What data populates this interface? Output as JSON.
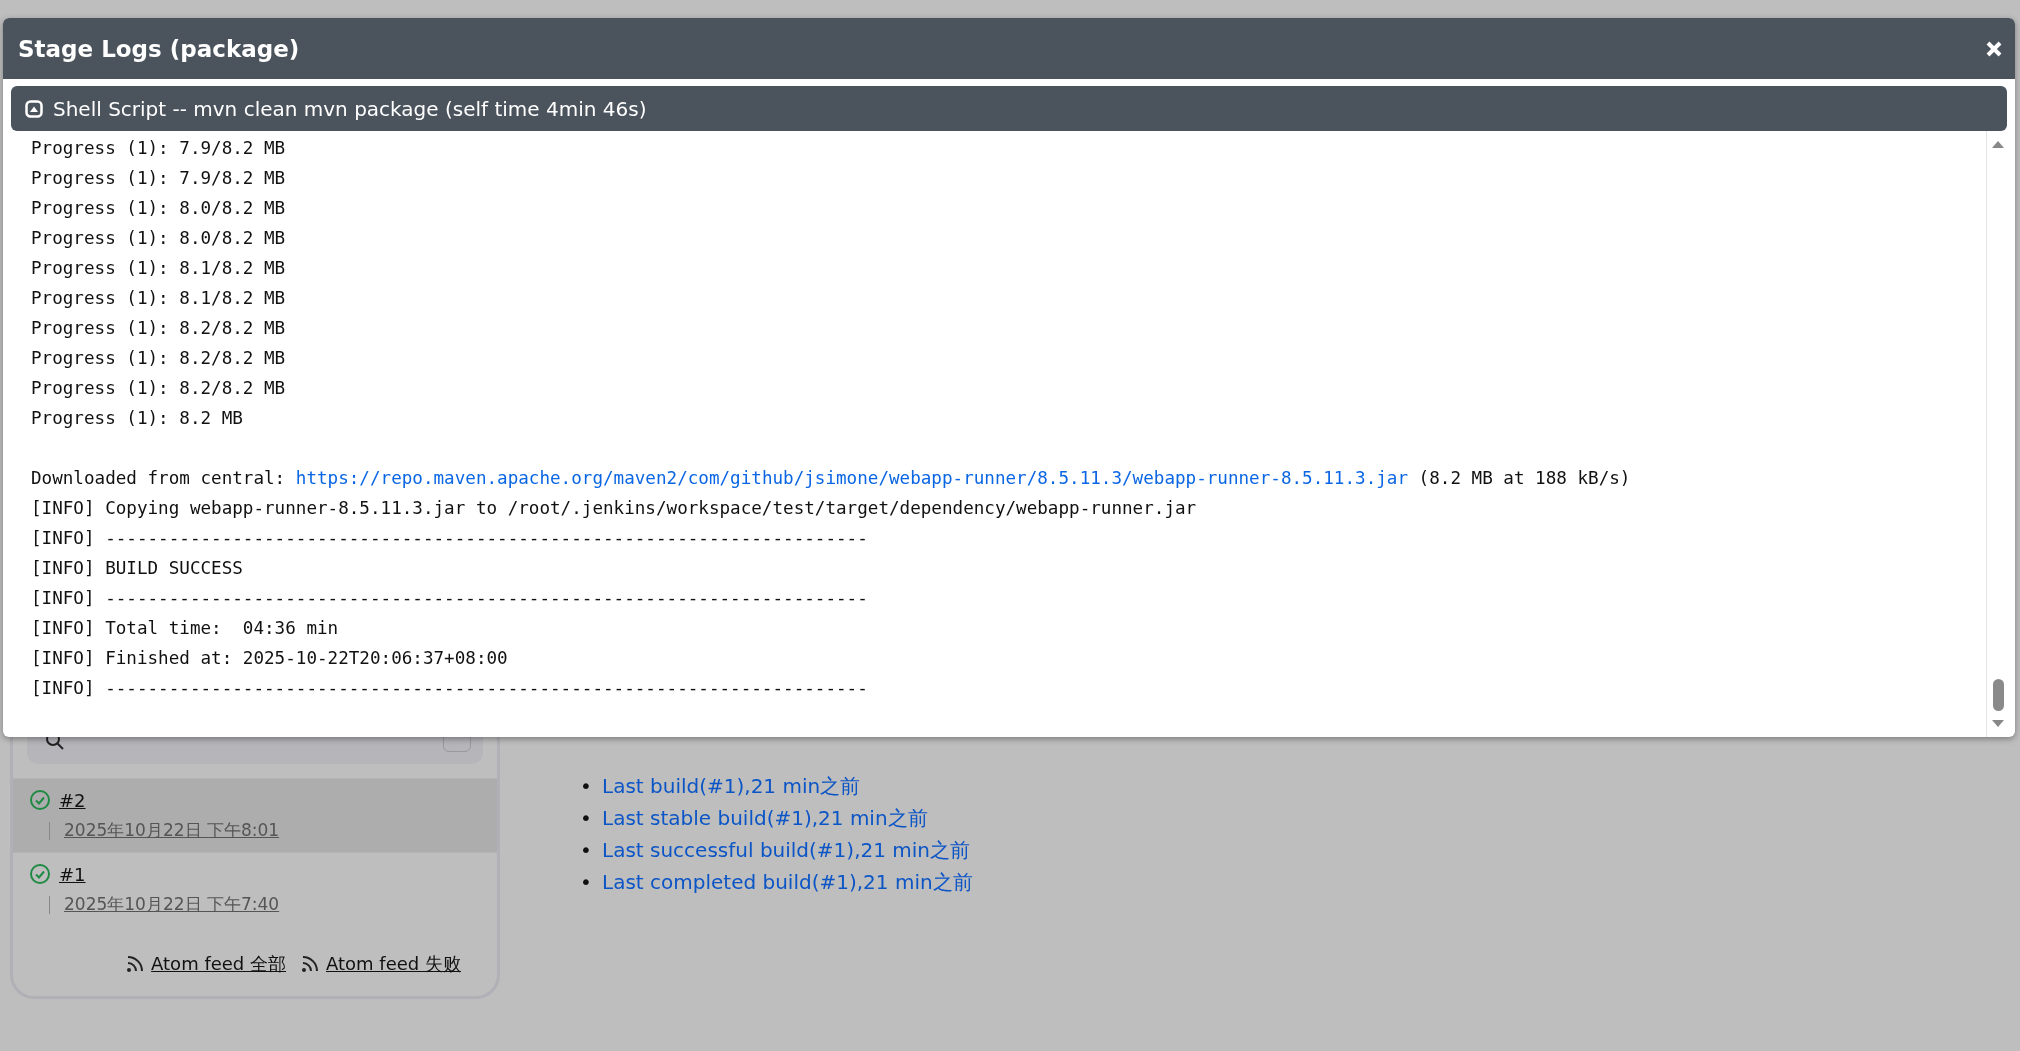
{
  "history": {
    "builds": [
      {
        "number": "#2",
        "date": "2025年10月22日 下午8:01",
        "selected": true
      },
      {
        "number": "#1",
        "date": "2025年10月22日 下午7:40",
        "selected": false
      }
    ],
    "feeds": [
      "Atom feed 全部",
      "Atom feed 失败"
    ]
  },
  "permalinks": [
    {
      "bullet": "•",
      "label": "Last build(#1),21 min之前"
    },
    {
      "bullet": "•",
      "label": "Last stable build(#1),21 min之前"
    },
    {
      "bullet": "•",
      "label": "Last successful build(#1),21 min之前"
    },
    {
      "bullet": "•",
      "label": "Last completed build(#1),21 min之前"
    }
  ],
  "dialog": {
    "title": "Stage Logs (package)",
    "step": {
      "title": "Shell Script -- mvn clean mvn package (self time 4min 46s)",
      "expanded": true
    },
    "log_lines": [
      {
        "text": "Progress (1): 7.9/8.2 MB"
      },
      {
        "text": "Progress (1): 7.9/8.2 MB"
      },
      {
        "text": "Progress (1): 8.0/8.2 MB"
      },
      {
        "text": "Progress (1): 8.0/8.2 MB"
      },
      {
        "text": "Progress (1): 8.1/8.2 MB"
      },
      {
        "text": "Progress (1): 8.1/8.2 MB"
      },
      {
        "text": "Progress (1): 8.2/8.2 MB"
      },
      {
        "text": "Progress (1): 8.2/8.2 MB"
      },
      {
        "text": "Progress (1): 8.2/8.2 MB"
      },
      {
        "text": "Progress (1): 8.2 MB"
      },
      {
        "kind": "blank"
      },
      {
        "text": "Downloaded from central: ",
        "link": "https://repo.maven.apache.org/maven2/com/github/jsimone/webapp-runner/8.5.11.3/webapp-runner-8.5.11.3.jar",
        "after": " (8.2 MB at 188 kB/s)"
      },
      {
        "text": "[INFO] Copying webapp-runner-8.5.11.3.jar to /root/.jenkins/workspace/test/target/dependency/webapp-runner.jar"
      },
      {
        "text": "[INFO] ------------------------------------------------------------------------"
      },
      {
        "text": "[INFO] BUILD SUCCESS"
      },
      {
        "text": "[INFO] ------------------------------------------------------------------------"
      },
      {
        "text": "[INFO] Total time:  04:36 min"
      },
      {
        "text": "[INFO] Finished at: 2025-10-22T20:06:37+08:00"
      },
      {
        "text": "[INFO] ------------------------------------------------------------------------"
      }
    ]
  }
}
